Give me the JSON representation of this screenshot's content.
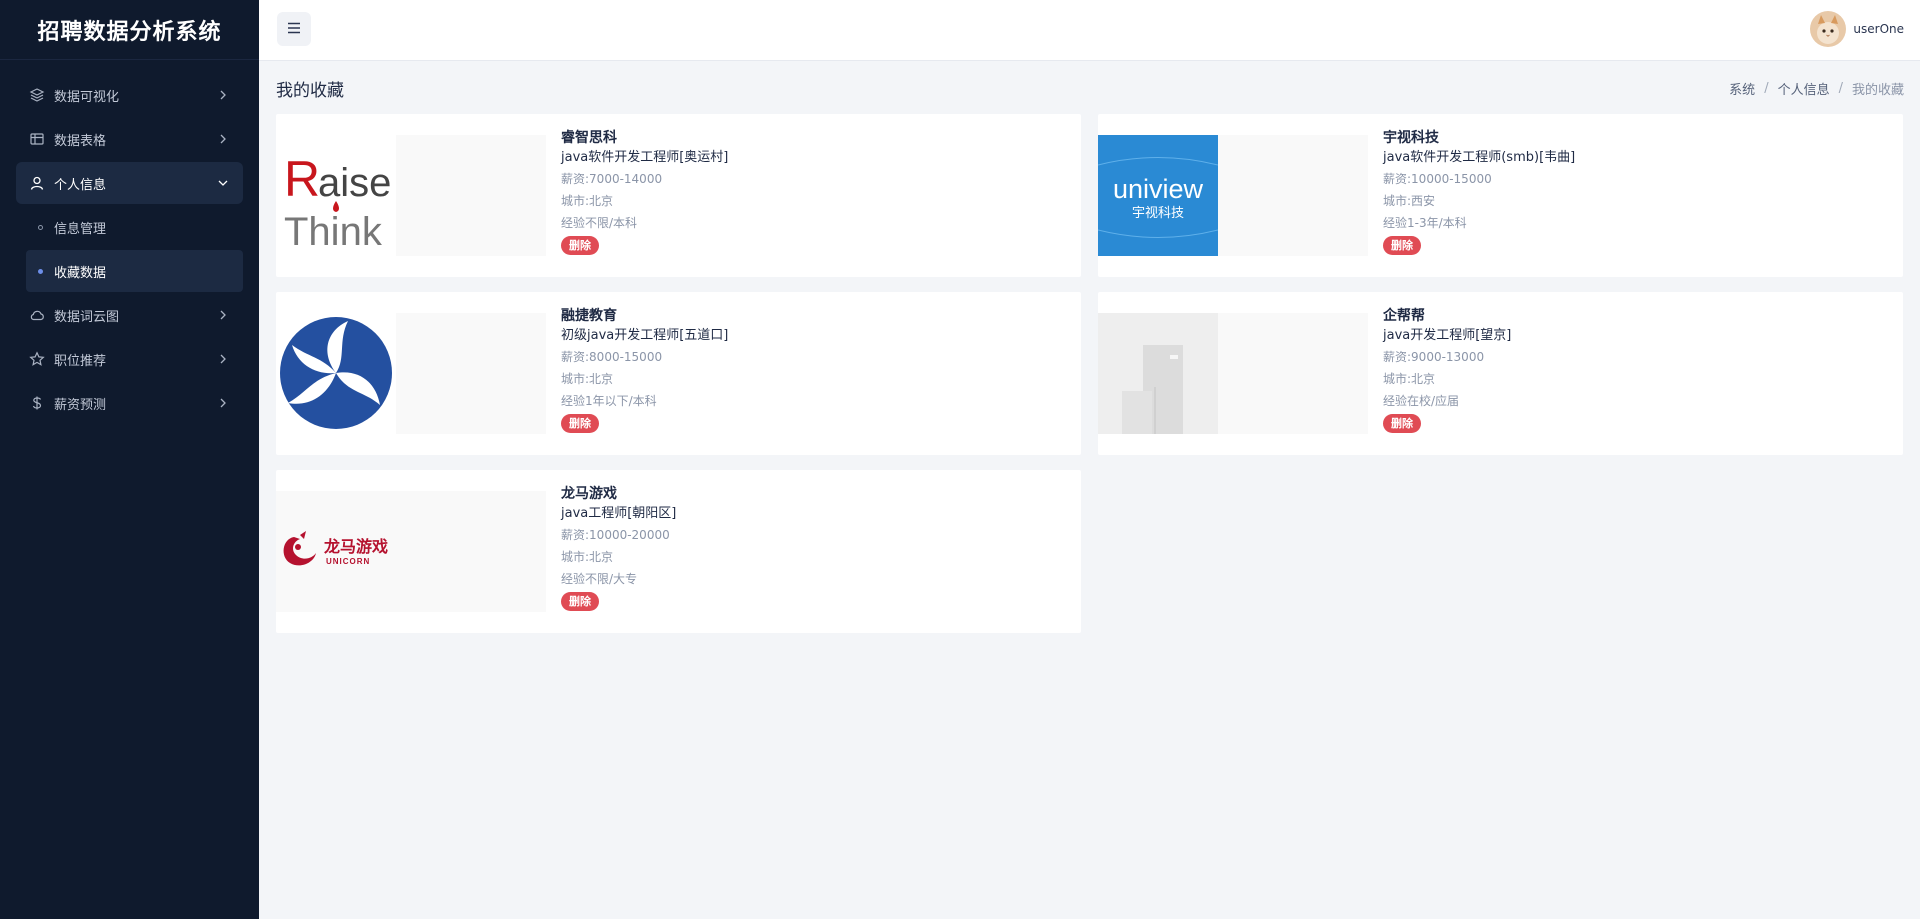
{
  "app": {
    "title": "招聘数据分析系统"
  },
  "sidebar": {
    "items": [
      {
        "label": "数据可视化",
        "icon": "layers-icon"
      },
      {
        "label": "数据表格",
        "icon": "table-icon"
      },
      {
        "label": "个人信息",
        "icon": "user-icon",
        "open": true
      },
      {
        "label": "数据词云图",
        "icon": "cloud-icon"
      },
      {
        "label": "职位推荐",
        "icon": "star-icon"
      },
      {
        "label": "薪资预测",
        "icon": "dollar-icon"
      }
    ],
    "subitems": [
      {
        "label": "信息管理"
      },
      {
        "label": "收藏数据",
        "active": true
      }
    ]
  },
  "header": {
    "username": "userOne"
  },
  "page": {
    "title": "我的收藏",
    "breadcrumb": [
      "系统",
      "个人信息",
      "我的收藏"
    ]
  },
  "favorites": [
    {
      "company": "睿智思科",
      "job": "java软件开发工程师[奥运村]",
      "salary": "薪资:7000-14000",
      "city": "城市:北京",
      "exp": "经验不限/本科",
      "delete": "删除",
      "logo": "raise-think-logo"
    },
    {
      "company": "宇视科技",
      "job": "java软件开发工程师(smb)[韦曲]",
      "salary": "薪资:10000-15000",
      "city": "城市:西安",
      "exp": "经验1-3年/本科",
      "delete": "删除",
      "logo": "uniview-logo",
      "logo_text": "uniview",
      "logo_subtext": "宇视科技"
    },
    {
      "company": "融捷教育",
      "job": "初级java开发工程师[五道口]",
      "salary": "薪资:8000-15000",
      "city": "城市:北京",
      "exp": "经验1年以下/本科",
      "delete": "删除",
      "logo": "rongjie-logo"
    },
    {
      "company": "企帮帮",
      "job": "java开发工程师[望京]",
      "salary": "薪资:9000-13000",
      "city": "城市:北京",
      "exp": "经验在校/应届",
      "delete": "删除",
      "logo": "building-placeholder-logo"
    },
    {
      "company": "龙马游戏",
      "job": "java工程师[朝阳区]",
      "salary": "薪资:10000-20000",
      "city": "城市:北京",
      "exp": "经验不限/大专",
      "delete": "删除",
      "logo": "longma-logo",
      "logo_text": "龙马游戏",
      "logo_subtext": "UNICORN"
    }
  ],
  "colors": {
    "sidebar_bg": "#0f1a2d",
    "delete_red": "#e04b54",
    "accent_blue": "#6d8ee8"
  }
}
